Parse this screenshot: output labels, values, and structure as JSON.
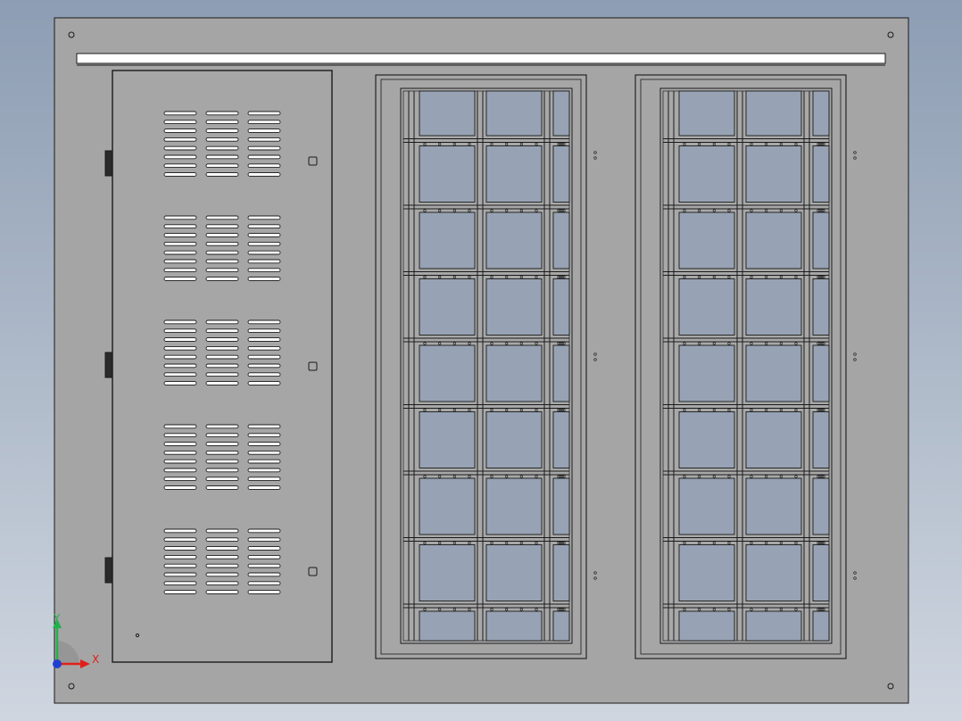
{
  "viewport": {
    "background_top": "#8d9db3",
    "background_bottom": "#cfd6e0"
  },
  "drawing": {
    "sheet_color": "#a5a5a5",
    "line_color": "#1a1a1a",
    "glass_color": "#97a3b4",
    "door": {
      "hinges": 3,
      "latches": 3,
      "louver_groups": 5,
      "louver_columns": 3,
      "slots_per_column": 8
    },
    "cabinets": [
      {
        "name": "cabinet-1",
        "rows": 9,
        "columns": 3
      },
      {
        "name": "cabinet-2",
        "rows": 9,
        "columns": 3
      }
    ]
  },
  "triad": {
    "x_label": "X",
    "y_label": "Y",
    "x_color": "#e0201a",
    "y_color": "#22b14c",
    "z_color": "#1f3fd0"
  }
}
